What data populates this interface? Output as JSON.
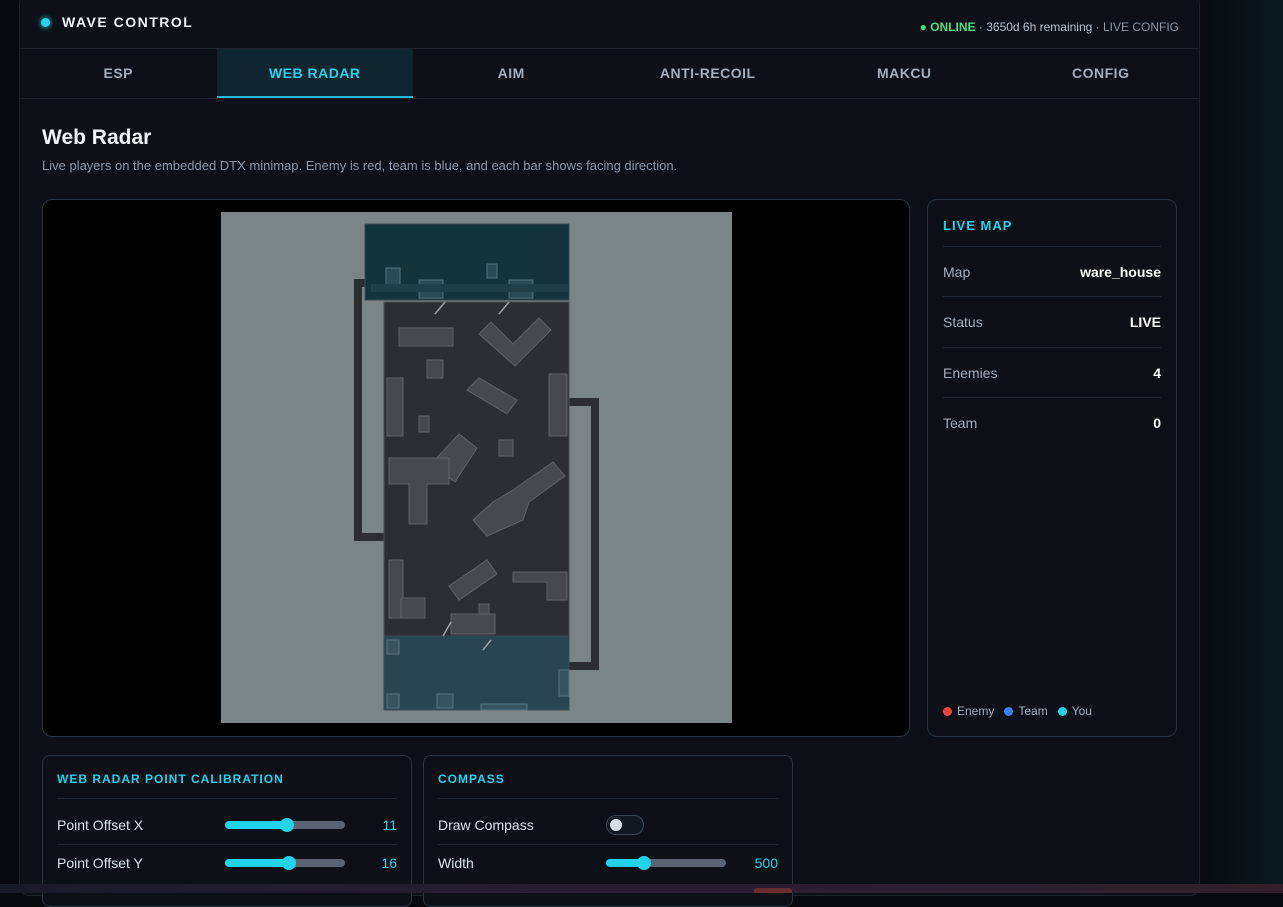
{
  "header": {
    "brand": "WAVE CONTROL",
    "status": "● ONLINE",
    "remaining": "· 3650d 6h remaining",
    "mode": "· LIVE CONFIG"
  },
  "tabs": [
    {
      "label": "ESP",
      "active": false
    },
    {
      "label": "WEB RADAR",
      "active": true
    },
    {
      "label": "AIM",
      "active": false
    },
    {
      "label": "ANTI-RECOIL",
      "active": false
    },
    {
      "label": "MAKCU",
      "active": false
    },
    {
      "label": "CONFIG",
      "active": false
    }
  ],
  "page": {
    "title": "Web Radar",
    "subtitle": "Live players on the embedded DTX minimap. Enemy is red, team is blue, and each bar shows facing direction."
  },
  "live_map": {
    "title": "LIVE MAP",
    "rows": [
      {
        "label": "Map",
        "value": "ware_house"
      },
      {
        "label": "Status",
        "value": "LIVE"
      },
      {
        "label": "Enemies",
        "value": "4"
      },
      {
        "label": "Team",
        "value": "0"
      }
    ],
    "legend": [
      {
        "label": "Enemy",
        "color": "#ef4444"
      },
      {
        "label": "Team",
        "color": "#3b82f6"
      },
      {
        "label": "You",
        "color": "#22d3ee"
      }
    ]
  },
  "calibration": {
    "title": "WEB RADAR POINT CALIBRATION",
    "controls": [
      {
        "label": "Point Offset X",
        "value": "11",
        "fraction": 0.52
      },
      {
        "label": "Point Offset Y",
        "value": "16",
        "fraction": 0.53
      }
    ]
  },
  "compass": {
    "title": "COMPASS",
    "draw_label": "Draw Compass",
    "draw_enabled": false,
    "width_label": "Width",
    "width_value": "500",
    "width_fraction": 0.32
  },
  "colors": {
    "accent": "#22d3ee",
    "online": "#4ade80",
    "panel": "#0d1117",
    "map_bg": "#7c8585"
  }
}
